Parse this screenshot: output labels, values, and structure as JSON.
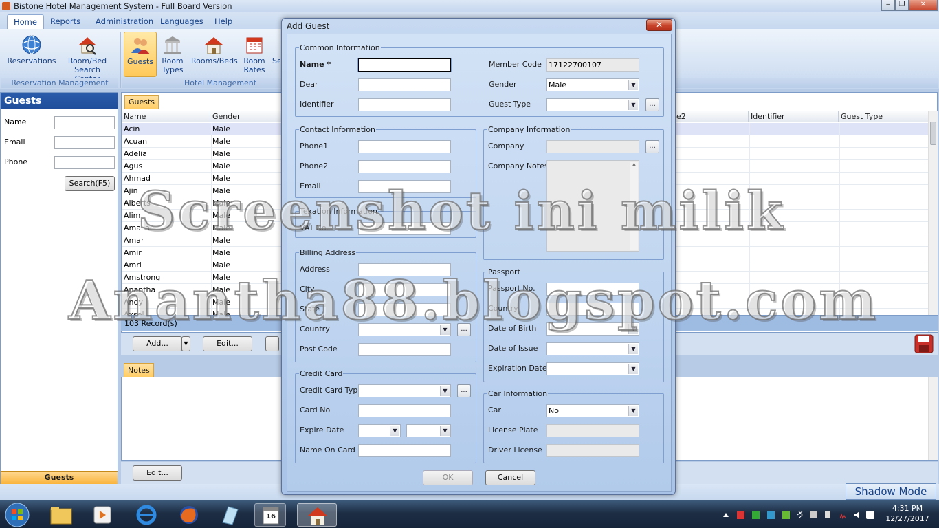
{
  "window": {
    "title": "Bistone Hotel Management System - Full Board Version",
    "min": "‒",
    "max": "❐",
    "close": "✕"
  },
  "menu": {
    "tabs": [
      "Home",
      "Reports",
      "Administration",
      "Languages",
      "Help"
    ]
  },
  "ribbon": {
    "reservation_group": {
      "label": "Reservation Management",
      "reservations": "Reservations",
      "search_center_1": "Room/Bed",
      "search_center_2": "Search Center"
    },
    "hotel_group": {
      "label": "Hotel Management",
      "guests": "Guests",
      "room_types_1": "Room",
      "room_types_2": "Types",
      "rooms_beds": "Rooms/Beds",
      "room_rates_1": "Room",
      "room_rates_2": "Rates",
      "cut": "Se"
    }
  },
  "left_panel": {
    "title": "Guests",
    "name_label": "Name",
    "email_label": "Email",
    "phone_label": "Phone",
    "search_button": "Search(F5)",
    "footer": "Guests"
  },
  "grid": {
    "tab": "Guests",
    "columns": {
      "name": "Name",
      "gender": "Gender",
      "phone2": "e2",
      "identifier": "Identifier",
      "guest_type": "Guest Type"
    },
    "rows": [
      {
        "name": "Acin",
        "gender": "Male"
      },
      {
        "name": "Acuan",
        "gender": "Male"
      },
      {
        "name": "Adelia",
        "gender": "Male"
      },
      {
        "name": "Agus",
        "gender": "Male"
      },
      {
        "name": "Ahmad",
        "gender": "Male"
      },
      {
        "name": "Ajin",
        "gender": "Male"
      },
      {
        "name": "Alberts",
        "gender": "Male"
      },
      {
        "name": "Alim",
        "gender": "Male"
      },
      {
        "name": "Amalia",
        "gender": "Male"
      },
      {
        "name": "Amar",
        "gender": "Male"
      },
      {
        "name": "Amir",
        "gender": "Male"
      },
      {
        "name": "Amri",
        "gender": "Male"
      },
      {
        "name": "Amstrong",
        "gender": "Male"
      },
      {
        "name": "Anantha",
        "gender": "Male"
      },
      {
        "name": "Andy",
        "gender": "Male"
      },
      {
        "name": "Axsel",
        "gender": "Male"
      }
    ],
    "record_count": "103 Record(s)",
    "add_button": "Add...",
    "edit_button": "Edit..."
  },
  "notes": {
    "tab": "Notes",
    "edit_button": "Edit..."
  },
  "status": {
    "shadow_mode": "Shadow Mode"
  },
  "taskbar": {
    "time": "4:31 PM",
    "date": "12/27/2017",
    "calendar_day": "16"
  },
  "dialog": {
    "title": "Add Guest",
    "close": "✕",
    "common": {
      "legend": "Common Information",
      "name_label": "Name *",
      "name_value": "",
      "dear_label": "Dear",
      "identifier_label": "Identifier",
      "member_code_label": "Member Code",
      "member_code_value": "17122700107",
      "gender_label": "Gender",
      "gender_value": "Male",
      "guest_type_label": "Guest Type",
      "guest_type_value": ""
    },
    "contact": {
      "legend": "Contact Information",
      "phone1_label": "Phone1",
      "phone2_label": "Phone2",
      "email_label": "Email"
    },
    "company": {
      "legend": "Company Information",
      "company_label": "Company",
      "notes_label": "Company Notes"
    },
    "taxation": {
      "legend": "Texation Information",
      "vat_label": "VAT No."
    },
    "billing": {
      "legend": "Billing Address",
      "address_label": "Address",
      "city_label": "City",
      "state_label": "State",
      "country_label": "Country",
      "postcode_label": "Post Code"
    },
    "passport": {
      "legend": "Passport",
      "passport_no_label": "Passport No.",
      "country_label": "Country",
      "dob_label": "Date of Birth",
      "doi_label": "Date of Issue",
      "expiry_label": "Expiration Date"
    },
    "credit_card": {
      "legend": "Credit Card",
      "type_label": "Credit Card Type",
      "card_no_label": "Card No",
      "expire_label": "Expire Date",
      "name_on_card_label": "Name On Card"
    },
    "car": {
      "legend": "Car Information",
      "car_label": "Car",
      "car_value": "No",
      "plate_label": "License Plate",
      "driver_label": "Driver License"
    },
    "ok_button": "OK",
    "cancel_button": "Cancel",
    "ellipsis": "..."
  },
  "watermark": {
    "line1": "Screenshot ini milik",
    "line2": "Anantha88.blogspot.com"
  },
  "colors": {
    "accent": "#15428b",
    "selection": "#ffc95a"
  }
}
